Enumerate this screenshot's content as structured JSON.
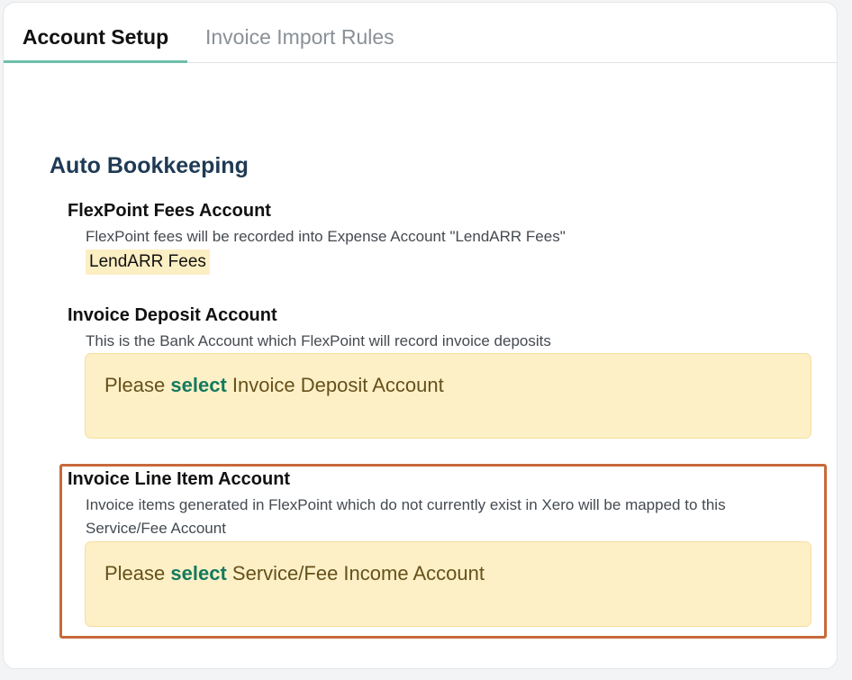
{
  "tabs": [
    {
      "label": "Account Setup",
      "active": true
    },
    {
      "label": "Invoice Import Rules",
      "active": false
    }
  ],
  "section": {
    "title": "Auto Bookkeeping"
  },
  "fees": {
    "label": "FlexPoint Fees Account",
    "description": "FlexPoint fees will be recorded into Expense Account \"LendARR Fees\"",
    "value": "LendARR Fees"
  },
  "deposit": {
    "label": "Invoice Deposit Account",
    "description": "This is the Bank Account which FlexPoint will record invoice deposits",
    "prompt_prefix": "Please",
    "prompt_link": "select",
    "prompt_suffix": "Invoice Deposit Account"
  },
  "line_item": {
    "label": "Invoice Line Item Account",
    "description_line1": "Invoice items generated in FlexPoint which do not currently exist in Xero will be mapped to this",
    "description_line2": "Service/Fee Account",
    "prompt_prefix": "Please",
    "prompt_link": "select",
    "prompt_suffix": "Service/Fee Income Account"
  },
  "colors": {
    "accent_tab_underline": "#6dbfab",
    "section_title": "#1f3a54",
    "select_link": "#137a5f",
    "select_box_bg": "#fdf0c7",
    "highlight_border": "#c76a3a"
  }
}
